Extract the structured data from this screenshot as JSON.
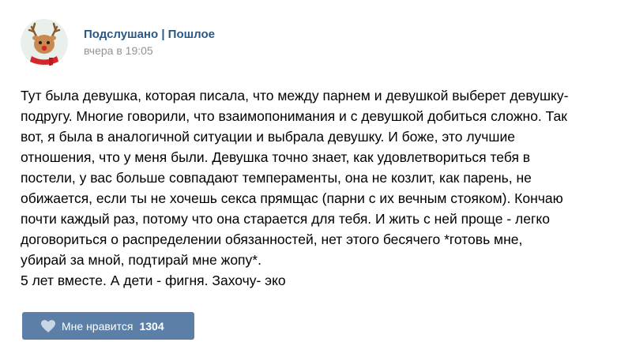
{
  "post": {
    "author": "Подслушано | Пошлое",
    "time": "вчера в 19:05",
    "text_lines": [
      "Тут была девушка, которая писала, что между парнем и девушкой выберет девушку-",
      "подругу. Многие говорили, что взаимопонимания и с девушкой добиться сложно. Так",
      "вот, я была в аналогичной ситуации и выбрала девушку. И боже, это лучшие",
      "отношения, что у меня были. Девушка точно знает, как удовлетвориться тебя в",
      "постели, у вас больше совпадают темпераменты, она не козлит, как парень, не",
      "обижается, если ты не хочешь секса прямщас (парни с их вечным стояком). Кончаю",
      "почти каждый раз, потому что она старается для тебя. И жить с ней проще - легко",
      "договориться о распределении обязанностей, нет этого бесячего *готовь мне,",
      "убирай за мной, подтирай мне жопу*.",
      "5 лет вместе. А дети - фигня. Захочу- эко"
    ]
  },
  "likes": {
    "label": "Мне нравится",
    "count": "1304"
  },
  "icons": {
    "avatar": "reindeer-avatar",
    "like": "heart-icon"
  },
  "colors": {
    "author_link": "#2a5885",
    "time": "#939393",
    "like_button_bg": "#5b7fa6",
    "text": "#000000"
  }
}
